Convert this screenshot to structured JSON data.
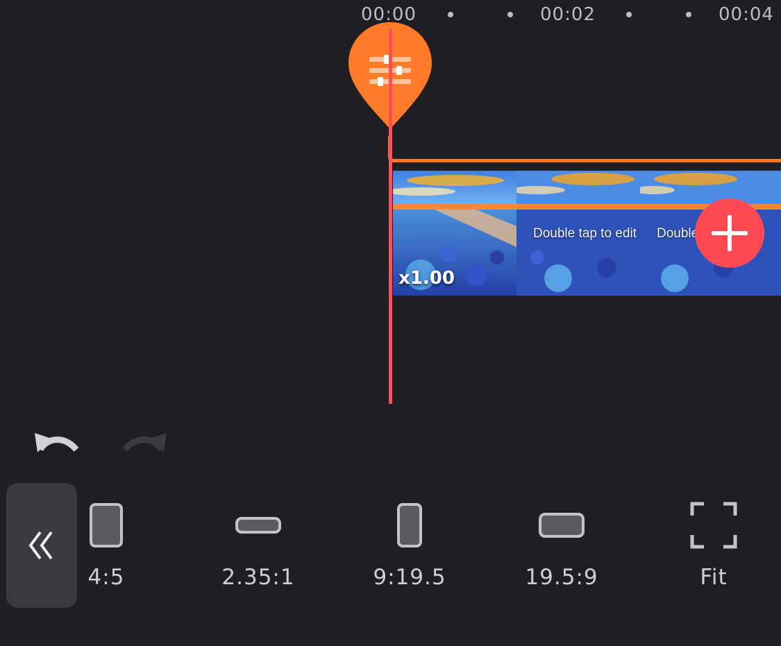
{
  "ruler": {
    "labels": [
      "00:00",
      "00:02",
      "00:04"
    ]
  },
  "timeline": {
    "clip_speed": "x1.00",
    "clip_caption": "Double tap to edit",
    "clip_caption_partial": "Double"
  },
  "icons": {
    "marker": "adjust-sliders-icon",
    "add": "plus-icon",
    "undo": "undo-icon",
    "redo": "redo-icon",
    "collapse": "double-chevron-left-icon"
  },
  "aspect_ratios": [
    {
      "label": "4:5"
    },
    {
      "label": "2.35:1"
    },
    {
      "label": "9:19.5"
    },
    {
      "label": "19.5:9"
    },
    {
      "label": "Fit"
    }
  ],
  "colors": {
    "background": "#1e1e23",
    "accent_orange": "#ff7a29",
    "playhead_red": "#ff4f5a",
    "add_button": "#ff4a55"
  }
}
